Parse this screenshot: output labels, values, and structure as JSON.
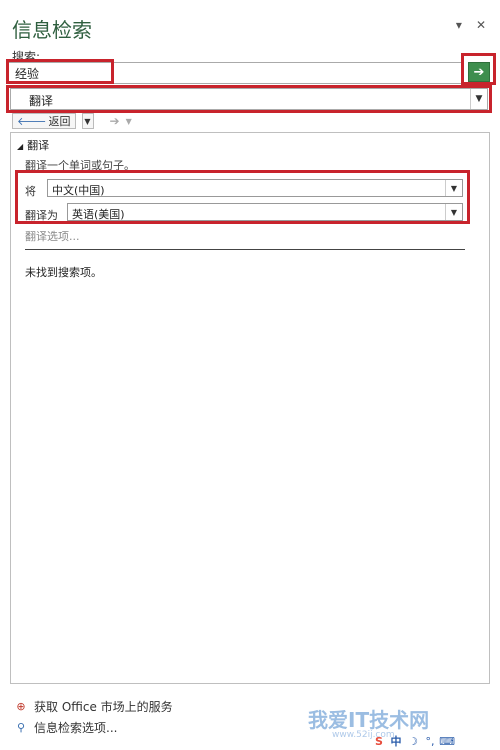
{
  "pane": {
    "title": "信息检索",
    "menu_glyph": "▾",
    "close_glyph": "✕"
  },
  "search": {
    "label": "搜索:",
    "value": "经验",
    "go_glyph": "➔"
  },
  "source": {
    "selected": "翻译"
  },
  "nav": {
    "back_label": "返回",
    "back_glyph": "🡐",
    "forward_glyph": "➔"
  },
  "results": {
    "section_title": "翻译",
    "hint": "翻译一个单词或句子。",
    "from_label": "将",
    "from_value": "中文(中国)",
    "to_label": "翻译为",
    "to_value": "英语(美国)",
    "options_link": "翻译选项...",
    "no_results": "未找到搜索项。"
  },
  "footer": {
    "market_label": "获取 Office 市场上的服务",
    "options_label": "信息检索选项..."
  },
  "watermark": {
    "text": "我爱IT技术网",
    "url": "www.52ij.com"
  },
  "colors": {
    "title_green": "#2f5f3f",
    "go_button_green": "#3e8e4e",
    "highlight_red": "#c8232c"
  }
}
